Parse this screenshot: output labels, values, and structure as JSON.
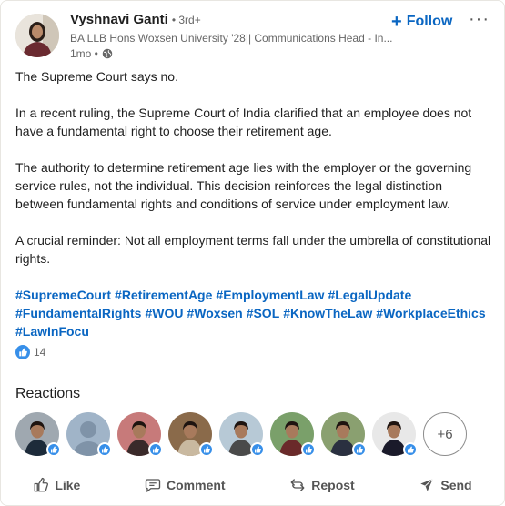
{
  "author": {
    "name": "Vyshnavi Ganti",
    "degree": "• 3rd+",
    "headline": "BA LLB Hons Woxsen University '28|| Communications Head - In...",
    "time": "1mo •",
    "avatar_icon": "profile-photo"
  },
  "header": {
    "follow_label": "Follow",
    "more_icon": "ellipsis-icon",
    "more_label": "···"
  },
  "post": {
    "paragraphs": [
      "The Supreme Court says no.",
      "In a recent ruling, the Supreme Court of India clarified that an employee does not have a fundamental right to choose their retirement age.",
      "The authority to determine retirement age lies with the employer or the governing service rules, not the individual. This decision reinforces the legal distinction between fundamental rights and conditions of service under employment law.",
      "A crucial reminder: Not all employment terms fall under the umbrella of constitutional rights."
    ],
    "hashtags": [
      "#SupremeCourt",
      "#RetirementAge",
      "#EmploymentLaw",
      "#LegalUpdate",
      "#FundamentalRights",
      "#WOU",
      "#Woxsen",
      "#SOL",
      "#KnowTheLaw",
      "#WorkplaceEthics",
      "#LawInFocu"
    ]
  },
  "reaction_count": "14",
  "reactions": {
    "title": "Reactions",
    "more_label": "+6",
    "people": [
      {
        "kind": "photo",
        "bg": "#9fa8b0",
        "body": "#1d2b3a"
      },
      {
        "kind": "placeholder",
        "bg": "#a0b4c8",
        "body": "#7f93a8"
      },
      {
        "kind": "photo",
        "bg": "#c77a7a",
        "body": "#3a2a2a"
      },
      {
        "kind": "photo",
        "bg": "#8a6a4a",
        "body": "#c9b9a0"
      },
      {
        "kind": "photo",
        "bg": "#b7c9d6",
        "body": "#4a4a4a"
      },
      {
        "kind": "photo",
        "bg": "#7aa06a",
        "body": "#6a2a2a"
      },
      {
        "kind": "photo",
        "bg": "#8aa070",
        "body": "#2a3040"
      },
      {
        "kind": "photo",
        "bg": "#e8e8e8",
        "body": "#1a1a2a"
      }
    ]
  },
  "actions": [
    {
      "label": "Like",
      "icon": "thumbs-up-icon"
    },
    {
      "label": "Comment",
      "icon": "comment-icon"
    },
    {
      "label": "Repost",
      "icon": "repost-icon"
    },
    {
      "label": "Send",
      "icon": "send-icon"
    }
  ],
  "colors": {
    "accent": "#0a66c2",
    "like": "#378fe9"
  }
}
